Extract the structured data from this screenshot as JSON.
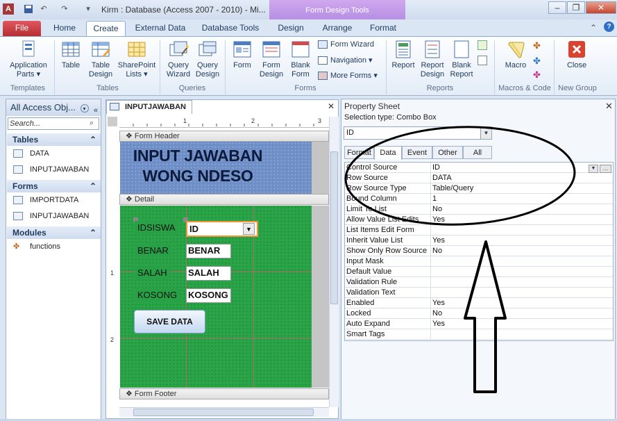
{
  "window": {
    "title": "Kirm : Database (Access 2007 - 2010)  -  Mi...",
    "contextual_band": "Form Design Tools",
    "min": "▭",
    "restore": "▭",
    "close": "✕"
  },
  "tabs": {
    "file": "File",
    "home": "Home",
    "create": "Create",
    "external": "External Data",
    "dbtools": "Database Tools",
    "design": "Design",
    "arrange": "Arrange",
    "format": "Format"
  },
  "ribbon": {
    "app_parts": "Application\nParts ▾",
    "table": "Table",
    "table_design": "Table\nDesign",
    "sharepoint": "SharePoint\nLists ▾",
    "query_wizard": "Query\nWizard",
    "query_design": "Query\nDesign",
    "form": "Form",
    "form_design": "Form\nDesign",
    "blank_form": "Blank\nForm",
    "form_wizard": "Form Wizard",
    "navigation": "Navigation ▾",
    "more_forms": "More Forms ▾",
    "report": "Report",
    "report_design": "Report\nDesign",
    "blank_report": "Blank\nReport",
    "macro": "Macro",
    "close": "Close",
    "groups": {
      "templates": "Templates",
      "tables": "Tables",
      "queries": "Queries",
      "forms": "Forms",
      "reports": "Reports",
      "macros": "Macros & Code",
      "new_group": "New Group"
    }
  },
  "nav": {
    "header": "All Access Obj...",
    "search_placeholder": "Search...",
    "sections": {
      "tables": "Tables",
      "forms": "Forms",
      "modules": "Modules"
    },
    "tables": [
      "DATA",
      "INPUTJAWABAN"
    ],
    "forms": [
      "IMPORTDATA",
      "INPUTJAWABAN"
    ],
    "modules": [
      "functions"
    ]
  },
  "document": {
    "tab": "INPUTJAWABAN",
    "ruler": [
      "1",
      "2",
      "3"
    ],
    "vruler": [
      "1",
      "2"
    ],
    "sections": {
      "header": "Form Header",
      "detail": "Detail",
      "footer": "Form Footer"
    },
    "header_title": "INPUT JAWABAN WONG NDESO",
    "fields": [
      {
        "label": "IDSISWA",
        "value": "ID"
      },
      {
        "label": "BENAR",
        "value": "BENAR"
      },
      {
        "label": "SALAH",
        "value": "SALAH"
      },
      {
        "label": "KOSONG",
        "value": "KOSONG"
      }
    ],
    "button": "SAVE DATA"
  },
  "props": {
    "title": "Property Sheet",
    "selection_type": "Selection type:  Combo Box",
    "object": "ID",
    "tabs": [
      "Format",
      "Data",
      "Event",
      "Other",
      "All"
    ],
    "rows": [
      {
        "name": "Control Source",
        "value": "ID"
      },
      {
        "name": "Row Source",
        "value": "DATA"
      },
      {
        "name": "Row Source Type",
        "value": "Table/Query"
      },
      {
        "name": "Bound Column",
        "value": "1"
      },
      {
        "name": "Limit To List",
        "value": "No"
      },
      {
        "name": "Allow Value List Edits",
        "value": "Yes"
      },
      {
        "name": "List Items Edit Form",
        "value": ""
      },
      {
        "name": "Inherit Value List",
        "value": "Yes"
      },
      {
        "name": "Show Only Row Source",
        "value": "No"
      },
      {
        "name": "Input Mask",
        "value": ""
      },
      {
        "name": "Default Value",
        "value": ""
      },
      {
        "name": "Validation Rule",
        "value": ""
      },
      {
        "name": "Validation Text",
        "value": ""
      },
      {
        "name": "Enabled",
        "value": "Yes"
      },
      {
        "name": "Locked",
        "value": "No"
      },
      {
        "name": "Auto Expand",
        "value": "Yes"
      },
      {
        "name": "Smart Tags",
        "value": ""
      }
    ]
  },
  "colors": {
    "detail_bg": "#29a548",
    "header_bg": "#6d8ec7",
    "accent": "#f29436"
  }
}
